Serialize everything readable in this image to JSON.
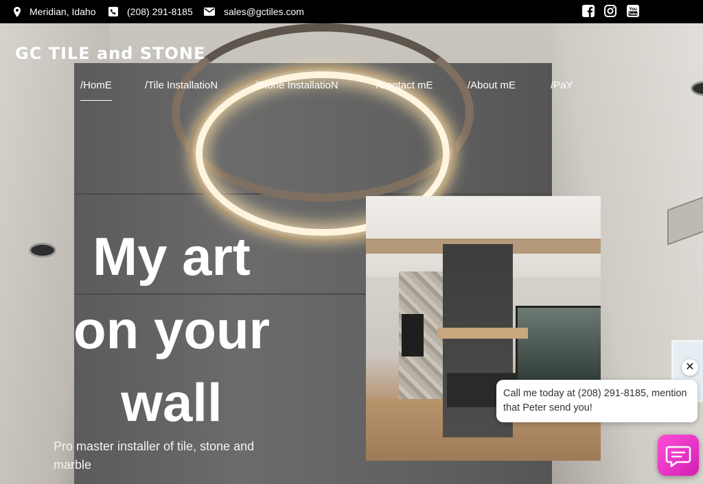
{
  "topbar": {
    "location": "Meridian, Idaho",
    "phone": "(208) 291-8185",
    "email": "sales@gctiles.com",
    "social": [
      "facebook-icon",
      "instagram-icon",
      "youtube-icon"
    ]
  },
  "brand": {
    "logo_text": "GC TILE and STONE"
  },
  "nav": {
    "items": [
      {
        "label": "/HomE",
        "active": true
      },
      {
        "label": "/Tile InstallatioN"
      },
      {
        "label": "/Stone InstallatioN"
      },
      {
        "label": "/Contact mE"
      },
      {
        "label": "/About mE"
      },
      {
        "label": "/PaY"
      }
    ]
  },
  "hero": {
    "headline_lines": [
      "My art",
      "on your",
      "wall"
    ],
    "subline": "Pro master installer of tile, stone and marble"
  },
  "chat": {
    "message": "Call me today at (208) 291-8185, mention that Peter send you!",
    "close_glyph": "✕",
    "accent": "#e23fd0"
  }
}
